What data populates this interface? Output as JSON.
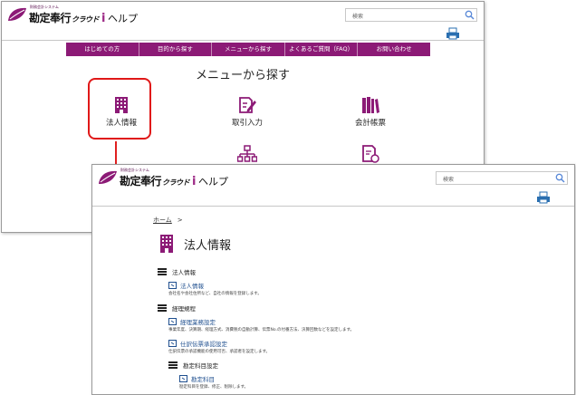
{
  "app": {
    "tagline": "財務会計システム",
    "brand": "勘定奉行",
    "brand_sub": "クラウド",
    "brand_i": "i",
    "help": "ヘルプ"
  },
  "top_window": {
    "search_placeholder": "検索",
    "nav": [
      "はじめての方",
      "目的から探す",
      "メニューから探す",
      "よくあるご質問（FAQ）",
      "お問い合わせ"
    ],
    "page_title": "メニューから探す",
    "menu_items": [
      {
        "label": "法人情報",
        "icon": "building-icon",
        "highlighted": true
      },
      {
        "label": "取引入力",
        "icon": "edit-document-icon",
        "highlighted": false
      },
      {
        "label": "会計帳票",
        "icon": "books-icon",
        "highlighted": false
      },
      {
        "label": "",
        "icon": "org-chart-icon",
        "highlighted": false
      },
      {
        "label": "",
        "icon": "refresh-document-icon",
        "highlighted": false
      }
    ]
  },
  "bottom_window": {
    "search_placeholder": "検索",
    "breadcrumb": {
      "home": "ホーム",
      "sep": ">"
    },
    "page_title": "法人情報",
    "sections": [
      {
        "title": "法人情報",
        "links": [
          {
            "label": "法人情報",
            "desc": "会社名や会社住所など、自社の情報を登録します。"
          }
        ]
      },
      {
        "title": "経理規程",
        "links": [
          {
            "label": "経理業務設定",
            "desc": "事業年度、決算期、経理方式、消費税の自動計算、伝票No.の付番方法、決算回数などを設定します。"
          },
          {
            "label": "仕訳伝票承認設定",
            "desc": "仕訳伝票の承認機能の使用可否、承認者を設定します。"
          }
        ]
      },
      {
        "title": "勘定科目設定",
        "links": [
          {
            "label": "勘定科目",
            "desc": "勘定科目を登録、修正、削除します。"
          }
        ]
      }
    ]
  },
  "colors": {
    "accent": "#8c1a76",
    "highlight": "#e01818",
    "link": "#1f4f8f"
  }
}
